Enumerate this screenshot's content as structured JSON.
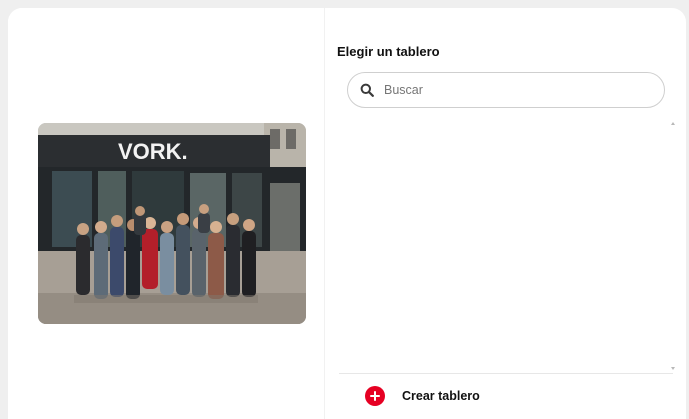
{
  "pin": {
    "storefront_sign": "VORK."
  },
  "board_picker": {
    "title": "Elegir un tablero",
    "search": {
      "placeholder": "Buscar",
      "value": ""
    },
    "create_board_label": "Crear tablero"
  },
  "colors": {
    "accent_red": "#e60023",
    "background": "#efefef",
    "panel": "#ffffff",
    "text": "#111111"
  },
  "icons": {
    "search": "search-icon",
    "create": "plus-circle-icon"
  }
}
